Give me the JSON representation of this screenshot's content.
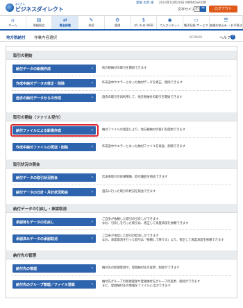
{
  "header": {
    "logo_sub": "あいぎん",
    "logo_text": "ビジネスダイレクト",
    "user_name": "愛銀 太郎 様",
    "last_login": "2014年03月20日 09時40分00秒",
    "font_size_label": "文字サイズ",
    "size_small": "小",
    "size_medium": "中",
    "size_large": "大",
    "logout": "ログアウト"
  },
  "nav": [
    {
      "label": "ホーム",
      "icon": "home-icon",
      "glyph": "⌂"
    },
    {
      "label": "明細照会",
      "icon": "document-icon",
      "glyph": "▤"
    },
    {
      "label": "資金移動",
      "icon": "transfer-icon",
      "glyph": "⇄"
    },
    {
      "label": "承認",
      "icon": "approve-icon",
      "glyph": "✎"
    },
    {
      "label": "管理",
      "icon": "settings-icon",
      "glyph": "⚙"
    },
    {
      "label": "がいため WEB",
      "icon": "foreign-exchange-icon",
      "glyph": "$"
    },
    {
      "label": "でんさいネット",
      "icon": "network-icon",
      "glyph": "◉"
    },
    {
      "label": "電子記録 サービス",
      "icon": "record-icon",
      "glyph": "▭"
    },
    {
      "label": "各種お申込み ・お手続き",
      "icon": "application-icon",
      "glyph": "☰"
    }
  ],
  "titlebar": {
    "crumb1": "地方税納付",
    "crumb2": "作業内容選択",
    "page_code": "BCZN001",
    "help": "ヘルプ",
    "help_icon": "?"
  },
  "sections": [
    {
      "title": "取引の開始",
      "rows": [
        {
          "label": "納付データの新規作成",
          "desc": [
            "地方税納付の取引を開始できます"
          ]
        },
        {
          "label": "作成中納付データの修正・削除",
          "desc": [
            "作成途中やエラーとなった納付データを修正、削除できます"
          ]
        },
        {
          "label": "過去の納付データからの作成",
          "desc": [
            "過去の取引を再利用して、地方税納付の取引を開始できます"
          ]
        }
      ]
    },
    {
      "title": "取引の開始（ファイル受付）",
      "rows": [
        {
          "label": "納付ファイルによる新規作成",
          "desc": [
            "納付ファイルの指定により、地方税納付の取引を開始できます"
          ]
        },
        {
          "label": "作成中納付ファイルの再送・削除",
          "desc": [
            "作成途中やエラーとなった納付ファイルを再送、削除できます"
          ]
        }
      ]
    },
    {
      "title": "取引状況の照会",
      "rows": [
        {
          "label": "納付データの取引状況照会",
          "desc": [
            "伝送系取引の詳細情報、取引履歴を照会できます"
          ]
        },
        {
          "label": "納付データの日計・月計状況照会",
          "desc": [
            "過去に行った取引の状況を照会できます"
          ]
        }
      ]
    },
    {
      "title": "納付データの引戻し・承認取消",
      "rows": [
        {
          "label": "承認待ちデータの引戻し",
          "desc": [
            "ご自身が依頼した取引の引戻しができます",
            "なお、引戻しを行った取引は、修正して再度承認を依頼できます"
          ]
        },
        {
          "label": "承認済みデータの承認取消",
          "desc": [
            "ご自身が承認した取引の取消しができます",
            "なお、承認取消を行った取引は「依頼して降りる」より、修正して再度承認を依頼できます"
          ]
        }
      ]
    },
    {
      "title": "納付先の管理",
      "rows": [
        {
          "label": "納付先の管理",
          "desc": [
            "納付先の新規登録や、登録納付先の変更、削除ができます"
          ]
        },
        {
          "label": "納付先のグループ管理／ファイル登録",
          "desc": [
            "納付先グループの新規登録や登録納付先グループの変更、削除ができます",
            "また、登録納付先の情報をファイルに出力できます"
          ]
        }
      ]
    }
  ],
  "chevron": "›"
}
